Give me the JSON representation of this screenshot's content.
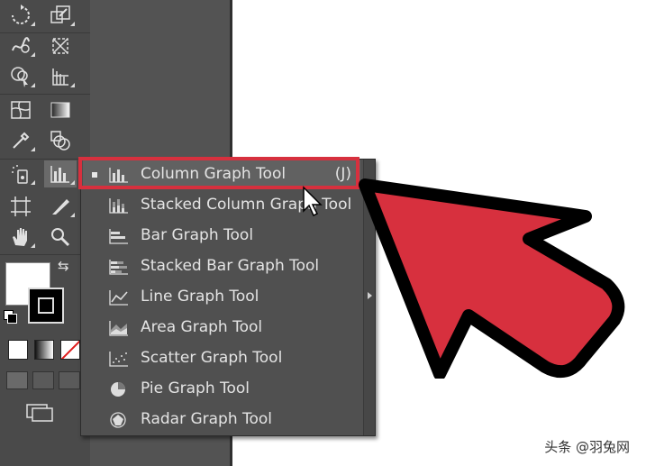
{
  "flyout_menu": {
    "items": [
      {
        "label": "Column Graph Tool",
        "shortcut": "(J)",
        "icon": "column-graph-icon",
        "selected": true
      },
      {
        "label": "Stacked Column Graph Tool",
        "shortcut": "",
        "icon": "stacked-column-graph-icon",
        "selected": false
      },
      {
        "label": "Bar Graph Tool",
        "shortcut": "",
        "icon": "bar-graph-icon",
        "selected": false
      },
      {
        "label": "Stacked Bar Graph Tool",
        "shortcut": "",
        "icon": "stacked-bar-graph-icon",
        "selected": false
      },
      {
        "label": "Line Graph Tool",
        "shortcut": "",
        "icon": "line-graph-icon",
        "selected": false
      },
      {
        "label": "Area Graph Tool",
        "shortcut": "",
        "icon": "area-graph-icon",
        "selected": false
      },
      {
        "label": "Scatter Graph Tool",
        "shortcut": "",
        "icon": "scatter-graph-icon",
        "selected": false
      },
      {
        "label": "Pie Graph Tool",
        "shortcut": "",
        "icon": "pie-graph-icon",
        "selected": false
      },
      {
        "label": "Radar Graph Tool",
        "shortcut": "",
        "icon": "radar-graph-icon",
        "selected": false
      }
    ]
  },
  "toolbar": {
    "tools": [
      "rotate-icon",
      "scale-icon",
      "warp-icon",
      "free-transform-icon",
      "shape-builder-icon",
      "perspective-grid-icon",
      "mesh-icon",
      "gradient-icon",
      "eyedropper-icon",
      "blend-icon",
      "symbol-sprayer-icon",
      "column-graph-icon",
      "artboard-icon",
      "slice-icon",
      "hand-icon",
      "zoom-icon"
    ]
  },
  "colors": {
    "toolbar_bg": "#4a4a4a",
    "menu_bg": "#505050",
    "highlight_red": "#d7303e",
    "arrow_red": "#d7303e",
    "canvas_gray": "#535353"
  },
  "watermark": {
    "text": "头条 @羽兔网"
  }
}
